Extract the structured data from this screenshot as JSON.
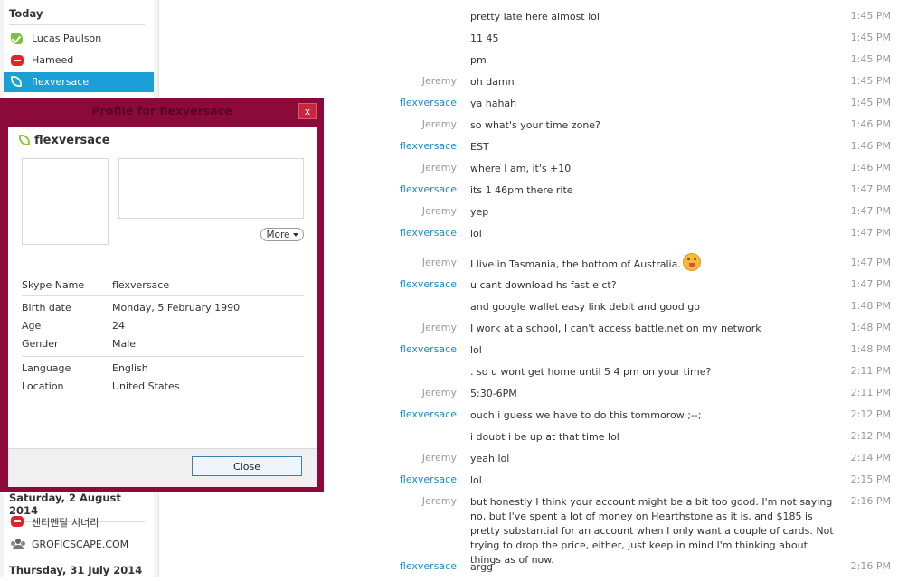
{
  "sidebar": {
    "groups": {
      "today": "Today",
      "saturday": "Saturday, 2 August 2014",
      "thursday": "Thursday, 31 July 2014"
    },
    "contacts": [
      {
        "name": "Lucas Paulson",
        "status": "online"
      },
      {
        "name": "Hameed",
        "status": "offline"
      },
      {
        "name": "flexversace",
        "status": "available"
      },
      {
        "name": "센티멘탈 시너리",
        "status": "offline"
      },
      {
        "name": "GROFICSCAPE.COM",
        "status": "group"
      }
    ]
  },
  "chat": {
    "messages": [
      {
        "sender": "",
        "text": "pretty late here almost lol",
        "time": "1:45 PM"
      },
      {
        "sender": "",
        "text": "11 45",
        "time": "1:45 PM"
      },
      {
        "sender": "",
        "text": "pm",
        "time": "1:45 PM"
      },
      {
        "sender": "Jeremy",
        "text": "oh damn",
        "time": "1:45 PM"
      },
      {
        "sender": "flexversace",
        "text": "ya hahah",
        "time": "1:45 PM"
      },
      {
        "sender": "Jeremy",
        "text": "so what's your time zone?",
        "time": "1:46 PM"
      },
      {
        "sender": "flexversace",
        "text": "EST",
        "time": "1:46 PM"
      },
      {
        "sender": "Jeremy",
        "text": "where I am, it's +10",
        "time": "1:46 PM"
      },
      {
        "sender": "flexversace",
        "text": "its 1 46pm there rite",
        "time": "1:47 PM"
      },
      {
        "sender": "Jeremy",
        "text": "yep",
        "time": "1:47 PM"
      },
      {
        "sender": "flexversace",
        "text": "lol",
        "time": "1:47 PM"
      },
      {
        "sender": "Jeremy",
        "text": "I live in Tasmania, the bottom of Australia.",
        "time": "1:47 PM"
      },
      {
        "sender": "flexversace",
        "text": "u cant download hs fast e ct?",
        "time": "1:47 PM"
      },
      {
        "sender": "",
        "text": "and google wallet easy link debit and good go",
        "time": "1:48 PM"
      },
      {
        "sender": "Jeremy",
        "text": "I work at a school, I can't access battle.net on my network",
        "time": "1:48 PM"
      },
      {
        "sender": "flexversace",
        "text": "lol",
        "time": "1:48 PM"
      },
      {
        "sender": "",
        "text": ".  so u wont get home until 5 4 pm on your time?",
        "time": "2:11 PM"
      },
      {
        "sender": "Jeremy",
        "text": "5:30-6PM",
        "time": "2:11 PM"
      },
      {
        "sender": "flexversace",
        "text": "ouch i guess we have to do this tommorow ;--;",
        "time": "2:12 PM"
      },
      {
        "sender": "",
        "text": "i doubt i be up at that time lol",
        "time": "2:12 PM"
      },
      {
        "sender": "Jeremy",
        "text": "yeah lol",
        "time": "2:14 PM"
      },
      {
        "sender": "flexversace",
        "text": "lol",
        "time": "2:15 PM"
      },
      {
        "sender": "Jeremy",
        "text": "but honestly I think your account might be a bit too good. I'm not saying no, but I've spent a lot of money on Hearthstone as it is, and $185 is pretty substantial for an account when I only want a couple of cards. Not trying to drop the price, either, just keep in mind I'm thinking about things as of now.",
        "time": "2:16 PM"
      },
      {
        "sender": "flexversace",
        "text": "argg",
        "time": "2:16 PM"
      }
    ]
  },
  "dialog": {
    "title": "Profile for flexversace",
    "close_x": "x",
    "name": "flexversace",
    "more_label": "More",
    "fields": {
      "skype_name_label": "Skype Name",
      "skype_name": "flexversace",
      "birth_label": "Birth date",
      "birth": "Monday, 5 February 1990",
      "age_label": "Age",
      "age": "24",
      "gender_label": "Gender",
      "gender": "Male",
      "language_label": "Language",
      "language": "English",
      "location_label": "Location",
      "location": "United States"
    },
    "close_label": "Close"
  }
}
